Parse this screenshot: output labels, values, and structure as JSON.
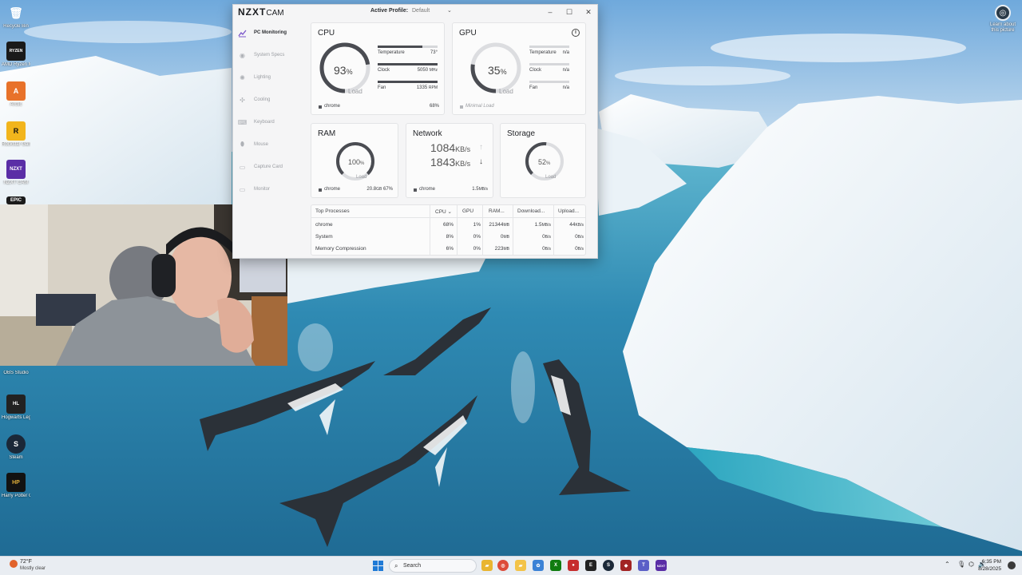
{
  "desktop": {
    "left_icons": [
      {
        "label": "Recycle Bin",
        "color": "#6d9ac2",
        "glyph": "🗑"
      },
      {
        "label": "AMD Ryzen Master",
        "color": "#1a1a1a",
        "glyph": "RYZEN"
      },
      {
        "label": "Arctic",
        "color": "#e8722a",
        "glyph": "A"
      },
      {
        "label": "Rockstar Games Launcher",
        "color": "#f2b51c",
        "glyph": "R"
      },
      {
        "label": "NZXT CAM",
        "color": "#5a2ea6",
        "glyph": "NZXT"
      },
      {
        "label": "EPIC",
        "color": "#1b1b1b",
        "glyph": "EPIC"
      }
    ],
    "lower_icons": [
      {
        "label": "OBS Studio",
        "color": "#2b2b2b",
        "glyph": "●"
      },
      {
        "label": "Hogwarts Legacy",
        "color": "#222222",
        "glyph": "HL"
      },
      {
        "label": "Steam",
        "color": "#1b2838",
        "glyph": "S"
      },
      {
        "label": "Harry Potter Quidditch",
        "color": "#121212",
        "glyph": "HP"
      }
    ],
    "right_icon": {
      "label": "Learn about this picture",
      "glyph": "◎"
    }
  },
  "cam": {
    "logo": "NZXT",
    "logo_suffix": "CAM",
    "active_profile_label": "Active Profile:",
    "active_profile_value": "Default",
    "nav": [
      {
        "label": "PC Monitoring",
        "icon": "chart-icon",
        "glyph": "📈",
        "active": true
      },
      {
        "label": "System Specs",
        "icon": "eye-icon",
        "glyph": "◉",
        "active": false
      },
      {
        "label": "Lighting",
        "icon": "sun-icon",
        "glyph": "✺",
        "active": false
      },
      {
        "label": "Cooling",
        "icon": "fan-icon",
        "glyph": "✣",
        "active": false
      },
      {
        "label": "Keyboard",
        "icon": "keyboard-icon",
        "glyph": "⌨",
        "active": false
      },
      {
        "label": "Mouse",
        "icon": "mouse-icon",
        "glyph": "⬮",
        "active": false
      },
      {
        "label": "Capture Card",
        "icon": "capture-icon",
        "glyph": "▭",
        "active": false
      },
      {
        "label": "Monitor",
        "icon": "monitor-icon",
        "glyph": "▭",
        "active": false
      }
    ],
    "cpu": {
      "title": "CPU",
      "load_value": "93",
      "load_unit": "%",
      "load_label": "Load",
      "load_fraction": 0.93,
      "temperature_label": "Temperature",
      "temperature_value": "73°",
      "temperature_fraction": 0.75,
      "clock_label": "Clock",
      "clock_value": "5050",
      "clock_unit": "MHz",
      "clock_fraction": 1.0,
      "fan_label": "Fan",
      "fan_value": "1335",
      "fan_unit": "RPM",
      "fan_fraction": 1.0,
      "top_process": "chrome",
      "top_process_value": "68%"
    },
    "gpu": {
      "title": "GPU",
      "info_icon": "info-icon",
      "load_value": "35",
      "load_unit": "%",
      "load_label": "Load",
      "load_fraction": 0.35,
      "temperature_label": "Temperature",
      "temperature_value": "n/a",
      "clock_label": "Clock",
      "clock_value": "n/a",
      "fan_label": "Fan",
      "fan_value": "n/a",
      "top_process": "Minimal Load"
    },
    "ram": {
      "title": "RAM",
      "load_value": "100",
      "load_unit": "%",
      "load_label": "Load",
      "load_fraction": 1.0,
      "top_process": "chrome",
      "top_process_value": "20.8",
      "top_process_unit": "GB",
      "top_process_pct": "67%"
    },
    "network": {
      "title": "Network",
      "download_value": "1084",
      "download_unit": "KB/s",
      "upload_value": "1843",
      "upload_unit": "KB/s",
      "top_process": "chrome",
      "top_process_value": "1.5",
      "top_process_unit": "MB/s"
    },
    "storage": {
      "title": "Storage",
      "load_value": "52",
      "load_unit": "%",
      "load_label": "Load",
      "load_fraction": 0.52
    },
    "processes": {
      "headers": [
        "Top Processes",
        "CPU",
        "GPU",
        "RAM...",
        "Download...",
        "Upload..."
      ],
      "rows": [
        {
          "name": "chrome",
          "cpu": "68%",
          "gpu": "1%",
          "ram": "21344",
          "ram_unit": "MB",
          "down": "1.5",
          "down_unit": "MB/s",
          "up": "44",
          "up_unit": "KB/s"
        },
        {
          "name": "System",
          "cpu": "8%",
          "gpu": "0%",
          "ram": "0",
          "ram_unit": "MB",
          "down": "0",
          "down_unit": "B/s",
          "up": "0",
          "up_unit": "B/s"
        },
        {
          "name": "Memory Compression",
          "cpu": "6%",
          "gpu": "0%",
          "ram": "223",
          "ram_unit": "MB",
          "down": "0",
          "down_unit": "B/s",
          "up": "0",
          "up_unit": "B/s"
        }
      ]
    }
  },
  "taskbar": {
    "weather_temp": "72°F",
    "weather_desc": "Mostly clear",
    "search_placeholder": "Search",
    "time": "6:35 PM",
    "date": "8/28/2025",
    "apps": [
      {
        "name": "file-explorer-icon",
        "color": "#e9b531",
        "glyph": "▰"
      },
      {
        "name": "chrome-icon",
        "color": "#dd4b39",
        "glyph": "◎"
      },
      {
        "name": "folder-icon",
        "color": "#f3c348",
        "glyph": "▰"
      },
      {
        "name": "photos-icon",
        "color": "#3b82d6",
        "glyph": "✿"
      },
      {
        "name": "xbox-icon",
        "color": "#107c10",
        "glyph": "X"
      },
      {
        "name": "app-red-icon",
        "color": "#c62d2d",
        "glyph": "●"
      },
      {
        "name": "epic-icon",
        "color": "#222222",
        "glyph": "E"
      },
      {
        "name": "steam-icon",
        "color": "#1b2838",
        "glyph": "S"
      },
      {
        "name": "game-icon",
        "color": "#a22424",
        "glyph": "◆"
      },
      {
        "name": "teams-icon",
        "color": "#5b5fc7",
        "glyph": "T"
      },
      {
        "name": "nzxt-icon",
        "color": "#5a2ea6",
        "glyph": "NZXT"
      }
    ]
  }
}
